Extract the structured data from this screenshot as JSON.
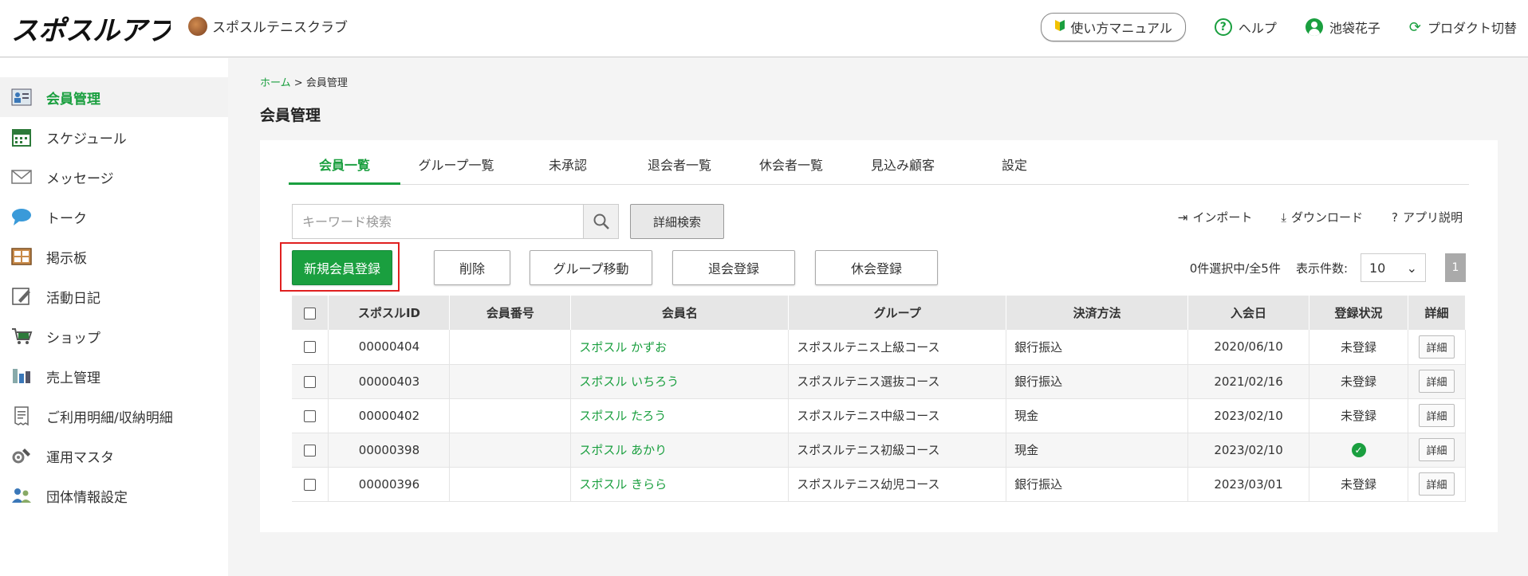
{
  "header": {
    "logo_text": "スポスルアプリ",
    "club_name": "スポスルテニスクラブ",
    "manual_label": "使い方マニュアル",
    "help_label": "ヘルプ",
    "user_name": "池袋花子",
    "product_switch_label": "プロダクト切替"
  },
  "sidebar": {
    "items": [
      {
        "label": "会員管理",
        "icon": "member-card-icon",
        "active": true
      },
      {
        "label": "スケジュール",
        "icon": "calendar-icon"
      },
      {
        "label": "メッセージ",
        "icon": "envelope-icon"
      },
      {
        "label": "トーク",
        "icon": "chat-bubble-icon"
      },
      {
        "label": "掲示板",
        "icon": "bulletin-board-icon"
      },
      {
        "label": "活動日記",
        "icon": "diary-icon"
      },
      {
        "label": "ショップ",
        "icon": "cart-icon"
      },
      {
        "label": "売上管理",
        "icon": "sales-icon"
      },
      {
        "label": "ご利用明細/収納明細",
        "icon": "receipt-icon"
      },
      {
        "label": "運用マスタ",
        "icon": "gear-wrench-icon"
      },
      {
        "label": "団体情報設定",
        "icon": "group-settings-icon"
      }
    ]
  },
  "breadcrumb": {
    "home": "ホーム",
    "separator": ">",
    "current": "会員管理"
  },
  "page_title": "会員管理",
  "tabs": [
    {
      "label": "会員一覧",
      "active": true
    },
    {
      "label": "グループ一覧"
    },
    {
      "label": "未承認"
    },
    {
      "label": "退会者一覧"
    },
    {
      "label": "休会者一覧"
    },
    {
      "label": "見込み顧客"
    },
    {
      "label": "設定"
    }
  ],
  "search": {
    "placeholder": "キーワード検索",
    "detail_label": "詳細検索"
  },
  "links": {
    "import": "インポート",
    "download": "ダウンロード",
    "app_help": "アプリ説明"
  },
  "actions": {
    "new_member": "新規会員登録",
    "delete": "削除",
    "move_group": "グループ移動",
    "withdraw": "退会登録",
    "suspend": "休会登録"
  },
  "list_info": {
    "selection": "0件選択中/全5件",
    "per_page_label": "表示件数:",
    "per_page_value": "10",
    "page": "1"
  },
  "table": {
    "headers": [
      "スポスルID",
      "会員番号",
      "会員名",
      "グループ",
      "決済方法",
      "入会日",
      "登録状況",
      "詳細"
    ],
    "rows": [
      {
        "id": "00000404",
        "number": "",
        "name": "スポスル かずお",
        "group": "スポスルテニス上級コース",
        "payment": "銀行振込",
        "joined": "2020/06/10",
        "status": "未登録",
        "detail": "詳細"
      },
      {
        "id": "00000403",
        "number": "",
        "name": "スポスル いちろう",
        "group": "スポスルテニス選抜コース",
        "payment": "銀行振込",
        "joined": "2021/02/16",
        "status": "未登録",
        "detail": "詳細"
      },
      {
        "id": "00000402",
        "number": "",
        "name": "スポスル たろう",
        "group": "スポスルテニス中級コース",
        "payment": "現金",
        "joined": "2023/02/10",
        "status": "未登録",
        "detail": "詳細"
      },
      {
        "id": "00000398",
        "number": "",
        "name": "スポスル あかり",
        "group": "スポスルテニス初級コース",
        "payment": "現金",
        "joined": "2023/02/10",
        "status": "",
        "detail": "詳細"
      },
      {
        "id": "00000396",
        "number": "",
        "name": "スポスル きらら",
        "group": "スポスルテニス幼児コース",
        "payment": "銀行振込",
        "joined": "2023/03/01",
        "status": "未登録",
        "detail": "詳細"
      }
    ]
  },
  "colors": {
    "accent": "#1a9f3f",
    "highlight_border": "#e02020"
  }
}
